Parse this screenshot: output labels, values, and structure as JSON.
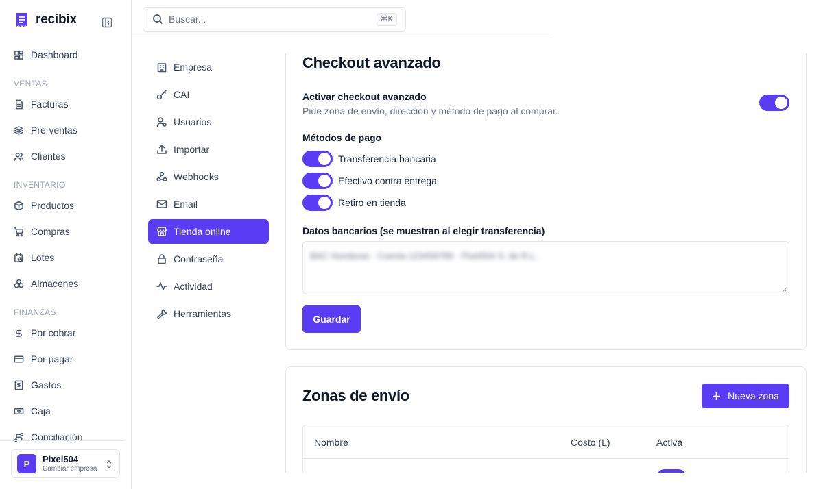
{
  "brand": {
    "name": "recibix"
  },
  "search": {
    "placeholder": "Buscar...",
    "shortcut": "⌘K"
  },
  "sidebar": {
    "dashboard": "Dashboard",
    "sections": {
      "ventas": "VENTAS",
      "inventario": "INVENTARIO",
      "finanzas": "FINANZAS"
    },
    "items": {
      "facturas": "Facturas",
      "preventas": "Pre-ventas",
      "clientes": "Clientes",
      "productos": "Productos",
      "compras": "Compras",
      "lotes": "Lotes",
      "almacenes": "Almacenes",
      "por_cobrar": "Por cobrar",
      "por_pagar": "Por pagar",
      "gastos": "Gastos",
      "caja": "Caja",
      "conciliacion": "Conciliación"
    },
    "company": {
      "initial": "P",
      "name": "Pixel504",
      "subtitle": "Cambiar empresa"
    }
  },
  "settings_menu": {
    "empresa": "Empresa",
    "cai": "CAI",
    "usuarios": "Usuarios",
    "importar": "Importar",
    "webhooks": "Webhooks",
    "email": "Email",
    "tienda": "Tienda online",
    "contrasena": "Contraseña",
    "actividad": "Actividad",
    "herramientas": "Herramientas",
    "active": "Tienda online"
  },
  "checkout": {
    "title": "Checkout avanzado",
    "enable_label": "Activar checkout avanzado",
    "enable_help": "Pide zona de envío, dirección y método de pago al comprar.",
    "enabled": true,
    "methods_title": "Métodos de pago",
    "methods": {
      "transfer": {
        "label": "Transferencia bancaria",
        "enabled": true
      },
      "cash": {
        "label": "Efectivo contra entrega",
        "enabled": true
      },
      "pickup": {
        "label": "Retiro en tienda",
        "enabled": true
      }
    },
    "bank_label": "Datos bancarios (se muestran al elegir transferencia)",
    "bank_value": "BAC Honduras · Cuenta 123456789 · Pixel504 S. de R.L.",
    "save": "Guardar"
  },
  "zones": {
    "title": "Zonas de envío",
    "new_zone": "Nueva zona",
    "columns": {
      "name": "Nombre",
      "cost": "Costo (L)",
      "active": "Activa"
    }
  },
  "colors": {
    "accent": "#5b3cf5",
    "border": "#e5e7eb",
    "muted": "#6b7280"
  }
}
